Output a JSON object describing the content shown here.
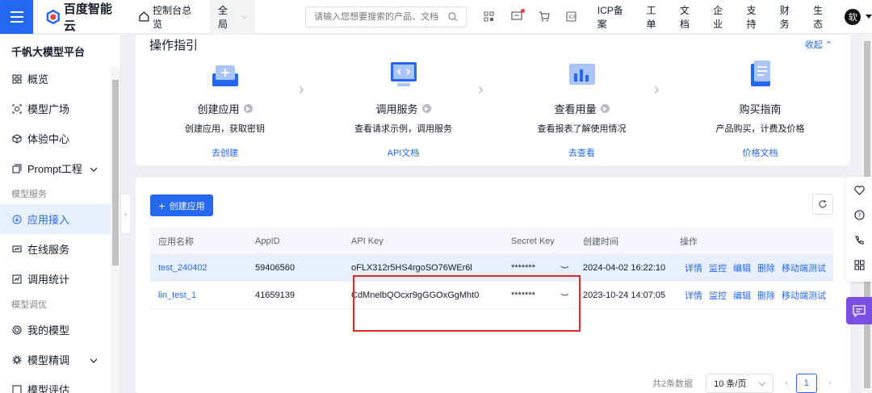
{
  "header": {
    "brand": "百度智能云",
    "console": "控制台总览",
    "region": "全局",
    "search_placeholder": "请输入您想要搜索的产品、文档",
    "links": [
      "ICP备案",
      "工单",
      "文档",
      "企业",
      "支持",
      "财务",
      "生态"
    ],
    "avatar_initial": "软"
  },
  "sidebar": {
    "title": "千帆大模型平台",
    "items": [
      {
        "label": "概览",
        "icon": "grid-icon"
      },
      {
        "label": "模型广场",
        "icon": "model-square-icon"
      },
      {
        "label": "体验中心",
        "icon": "cube-icon"
      },
      {
        "label": "Prompt工程",
        "icon": "prompt-icon"
      }
    ],
    "group1": "模型服务",
    "group1_items": [
      {
        "label": "应用接入",
        "icon": "plug-icon"
      },
      {
        "label": "在线服务",
        "icon": "monitor-icon"
      },
      {
        "label": "调用统计",
        "icon": "chart-icon"
      }
    ],
    "group2": "模型调优",
    "group2_items": [
      {
        "label": "我的模型",
        "icon": "target-icon"
      },
      {
        "label": "模型精调",
        "icon": "gear-icon"
      },
      {
        "label": "模型评估",
        "icon": "eval-icon"
      }
    ],
    "active": "应用接入"
  },
  "guide": {
    "title": "操作指引",
    "collapse": "收起",
    "steps": [
      {
        "name": "创建应用",
        "desc": "创建应用，获取密钥",
        "link": "去创建"
      },
      {
        "name": "调用服务",
        "desc": "查看请求示例，调用服务",
        "link": "API文档"
      },
      {
        "name": "查看用量",
        "desc": "查看报表了解使用情况",
        "link": "去查看"
      },
      {
        "name": "购买指南",
        "desc": "产品购买，计费及价格",
        "link": "价格文档"
      }
    ]
  },
  "table": {
    "create_button": "创建应用",
    "columns": [
      "应用名称",
      "AppID",
      "API Key",
      "Secret Key",
      "创建时间",
      "操作"
    ],
    "rows": [
      {
        "name": "test_240402",
        "appid": "59406560",
        "api_key": "oFLX312r5HS4rgoSO76WEr6l",
        "secret": "*******",
        "created": "2024-04-02 16:22:10"
      },
      {
        "name": "lin_test_1",
        "appid": "41659139",
        "api_key": "CdMnelbQOcxr9gGGOxGgMht0",
        "secret": "*******",
        "created": "2023-10-24 14:07:05"
      }
    ],
    "actions": [
      "详情",
      "监控",
      "编辑",
      "删除",
      "移动端测试"
    ]
  },
  "pagination": {
    "total": "共2条数据",
    "page_size": "10 条/页",
    "current": "1"
  },
  "colors": {
    "primary": "#2468f2",
    "highlight_box": "#e02a2a",
    "chat": "#7b4fe0"
  }
}
